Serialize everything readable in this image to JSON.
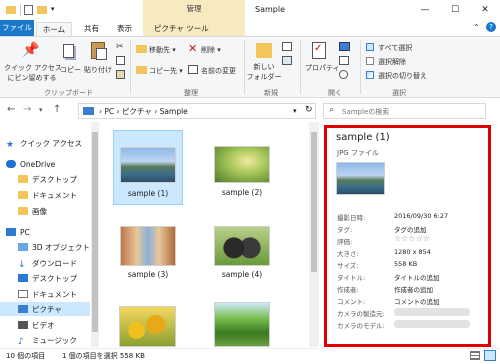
{
  "window": {
    "title": "Sample",
    "context_tab_group": "管理",
    "controls": [
      "—",
      "☐",
      "✕"
    ]
  },
  "ribbon": {
    "tabs": [
      "ファイル",
      "ホーム",
      "共有",
      "表示",
      "ピクチャ ツール"
    ],
    "clipboard": {
      "quick_access_line1": "クイック アクセス",
      "quick_access_line2": "にピン留めする",
      "copy": "コピー",
      "paste": "貼り付け",
      "group": "クリップボード"
    },
    "organize": {
      "move_to": "移動先 ▾",
      "copy_to": "コピー先 ▾",
      "delete": "削除 ▾",
      "rename": "名前の変更",
      "group": "整理"
    },
    "new": {
      "new_folder_line1": "新しい",
      "new_folder_line2": "フォルダー",
      "group": "新規"
    },
    "open": {
      "properties": "プロパティ",
      "group": "開く"
    },
    "select": {
      "select_all": "すべて選択",
      "select_none": "選択解除",
      "invert": "選択の切り替え",
      "group": "選択"
    }
  },
  "address": {
    "path": [
      "PC",
      "ピクチャ",
      "Sample"
    ],
    "search_placeholder": "Sampleの検索"
  },
  "nav": [
    {
      "label": "クイック アクセス",
      "icon": "star-icon"
    },
    {
      "label": "OneDrive",
      "icon": "cloud-icon"
    },
    {
      "label": "デスクトップ",
      "icon": "folder-icon"
    },
    {
      "label": "ドキュメント",
      "icon": "folder-icon"
    },
    {
      "label": "画像",
      "icon": "folder-icon"
    },
    {
      "label": "PC",
      "icon": "pc-icon"
    },
    {
      "label": "3D オブジェクト",
      "icon": "cube-icon"
    },
    {
      "label": "ダウンロード",
      "icon": "download-icon"
    },
    {
      "label": "デスクトップ",
      "icon": "desktop-icon"
    },
    {
      "label": "ドキュメント",
      "icon": "document-icon"
    },
    {
      "label": "ピクチャ",
      "icon": "picture-icon"
    },
    {
      "label": "ビデオ",
      "icon": "video-icon"
    },
    {
      "label": "ミュージック",
      "icon": "music-icon"
    }
  ],
  "files": [
    {
      "name": "sample (1)",
      "selected": true
    },
    {
      "name": "sample (2)",
      "selected": false
    },
    {
      "name": "sample (3)",
      "selected": false
    },
    {
      "name": "sample (4)",
      "selected": false
    },
    {
      "name": "",
      "selected": false
    },
    {
      "name": "",
      "selected": false
    }
  ],
  "details": {
    "title": "sample (1)",
    "type": "JPG ファイル",
    "rows": [
      {
        "key": "撮影日時:",
        "value": "2016/09/30 6:27"
      },
      {
        "key": "タグ:",
        "value": "タグの追加"
      },
      {
        "key": "評価:",
        "value": "☆☆☆☆☆"
      },
      {
        "key": "大きさ:",
        "value": "1280 x 854"
      },
      {
        "key": "サイズ:",
        "value": "558 KB"
      },
      {
        "key": "タイトル:",
        "value": "タイトルの追加"
      },
      {
        "key": "作成者:",
        "value": "作成者の追加"
      },
      {
        "key": "コメント:",
        "value": "コメントの追加"
      },
      {
        "key": "カメラの製造元:",
        "value": ""
      },
      {
        "key": "カメラのモデル:",
        "value": ""
      }
    ]
  },
  "status": {
    "count": "10 個の項目",
    "selection": "1 個の項目を選択 558 KB"
  },
  "colors": {
    "accent": "#1979ca",
    "highlight_border": "#e00000",
    "context_tab": "#f7eac0",
    "selection": "#cce8ff"
  }
}
